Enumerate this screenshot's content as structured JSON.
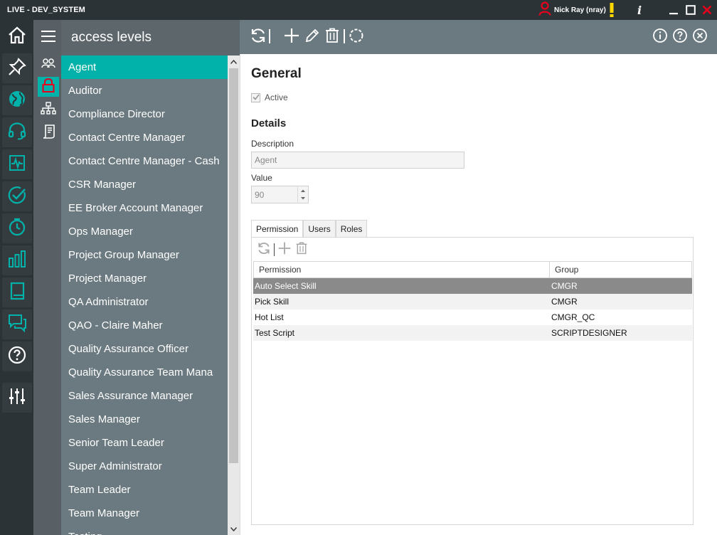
{
  "window": {
    "title": "LIVE - DEV_SYSTEM",
    "user": "Nick Ray (nray)",
    "colors": {
      "titlebar": "#2c3337",
      "accent": "#00b2a9",
      "close": "#e8001c",
      "warning": "#ffd800"
    }
  },
  "rail": {
    "items": [
      {
        "name": "home-icon",
        "color": "#ffffff"
      },
      {
        "name": "pin-icon",
        "color": "#ffffff"
      },
      {
        "name": "globe-icon",
        "color": "#00b2a9"
      },
      {
        "name": "headset-icon",
        "color": "#00b2a9"
      },
      {
        "name": "pulse-icon",
        "color": "#00b2a9"
      },
      {
        "name": "check-circle-icon",
        "color": "#00b2a9"
      },
      {
        "name": "clock-icon",
        "color": "#00b2a9"
      },
      {
        "name": "bar-chart-icon",
        "color": "#00b2a9"
      },
      {
        "name": "book-icon",
        "color": "#00b2a9"
      },
      {
        "name": "chat-icon",
        "color": "#00b2a9"
      },
      {
        "name": "help-icon",
        "color": "#ffffff"
      },
      {
        "name": "sliders-icon",
        "color": "#ffffff"
      }
    ]
  },
  "subrail": {
    "items": [
      {
        "name": "users-icon"
      },
      {
        "name": "lock-icon",
        "active": true
      },
      {
        "name": "hierarchy-icon"
      },
      {
        "name": "script-icon"
      }
    ]
  },
  "list": {
    "title": "access levels",
    "selected_index": 0,
    "items": [
      "Agent",
      "Auditor",
      "Compliance Director",
      "Contact Centre Manager",
      "Contact Centre Manager - Cash",
      "CSR Manager",
      "EE Broker Account Manager",
      "Ops Manager",
      "Project Group Manager",
      "Project Manager",
      "QA Administrator",
      "QAO - Claire Maher",
      "Quality Assurance Officer",
      "Quality Assurance Team Mana",
      "Sales Assurance Manager",
      "Sales Manager",
      "Senior Team Leader",
      "Super Administrator",
      "Team Leader",
      "Team Manager",
      "Testing"
    ]
  },
  "detail": {
    "general_title": "General",
    "active_label": "Active",
    "active_checked": true,
    "details_title": "Details",
    "description_label": "Description",
    "description_value": "Agent",
    "value_label": "Value",
    "value_value": "90",
    "tabs": [
      {
        "label": "Permission",
        "active": true
      },
      {
        "label": "Users",
        "active": false
      },
      {
        "label": "Roles",
        "active": false
      }
    ],
    "grid": {
      "columns": [
        "Permission",
        "Group"
      ],
      "selected_index": 0,
      "rows": [
        {
          "permission": "Auto Select Skill",
          "group": "CMGR"
        },
        {
          "permission": "Pick Skill",
          "group": "CMGR"
        },
        {
          "permission": "Hot List",
          "group": "CMGR_QC"
        },
        {
          "permission": "Test Script",
          "group": "SCRIPTDESIGNER"
        }
      ]
    }
  }
}
